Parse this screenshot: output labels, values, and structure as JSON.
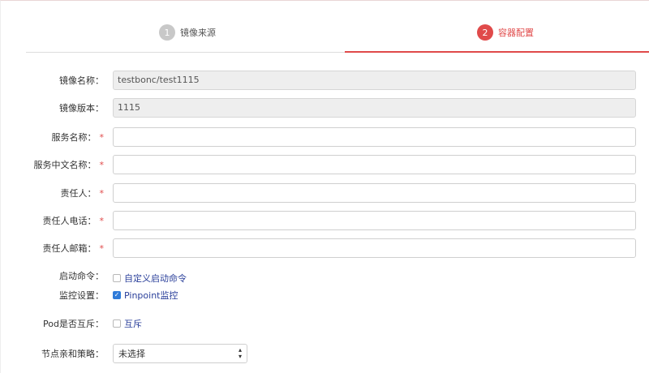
{
  "steps": [
    {
      "number": "1",
      "label": "镜像来源",
      "state": "done"
    },
    {
      "number": "2",
      "label": "容器配置",
      "state": "active"
    }
  ],
  "colors": {
    "accent": "#e04a4a",
    "link": "#2a3f9a",
    "check": "#2f7bd9"
  },
  "form": {
    "image_name": {
      "label": "镜像名称：",
      "value": "testbonc/test1115"
    },
    "image_version": {
      "label": "镜像版本：",
      "value": "1115"
    },
    "service_name": {
      "label": "服务名称：",
      "required_mark": "*",
      "value": ""
    },
    "service_cn_name": {
      "label": "服务中文名称：",
      "required_mark": "*",
      "value": ""
    },
    "owner": {
      "label": "责任人：",
      "required_mark": "*",
      "value": ""
    },
    "owner_phone": {
      "label": "责任人电话：",
      "required_mark": "*",
      "value": ""
    },
    "owner_email": {
      "label": "责任人邮箱：",
      "required_mark": "*",
      "value": ""
    },
    "start_command": {
      "label": "启动命令：",
      "option": "自定义启动命令",
      "checked": false
    },
    "monitoring": {
      "label": "监控设置：",
      "option": "Pinpoint监控",
      "checked": true
    },
    "pod_mutex": {
      "label": "Pod是否互斥：",
      "option": "互斥",
      "checked": false
    },
    "node_affinity": {
      "label": "节点亲和策略：",
      "selected": "未选择"
    }
  }
}
